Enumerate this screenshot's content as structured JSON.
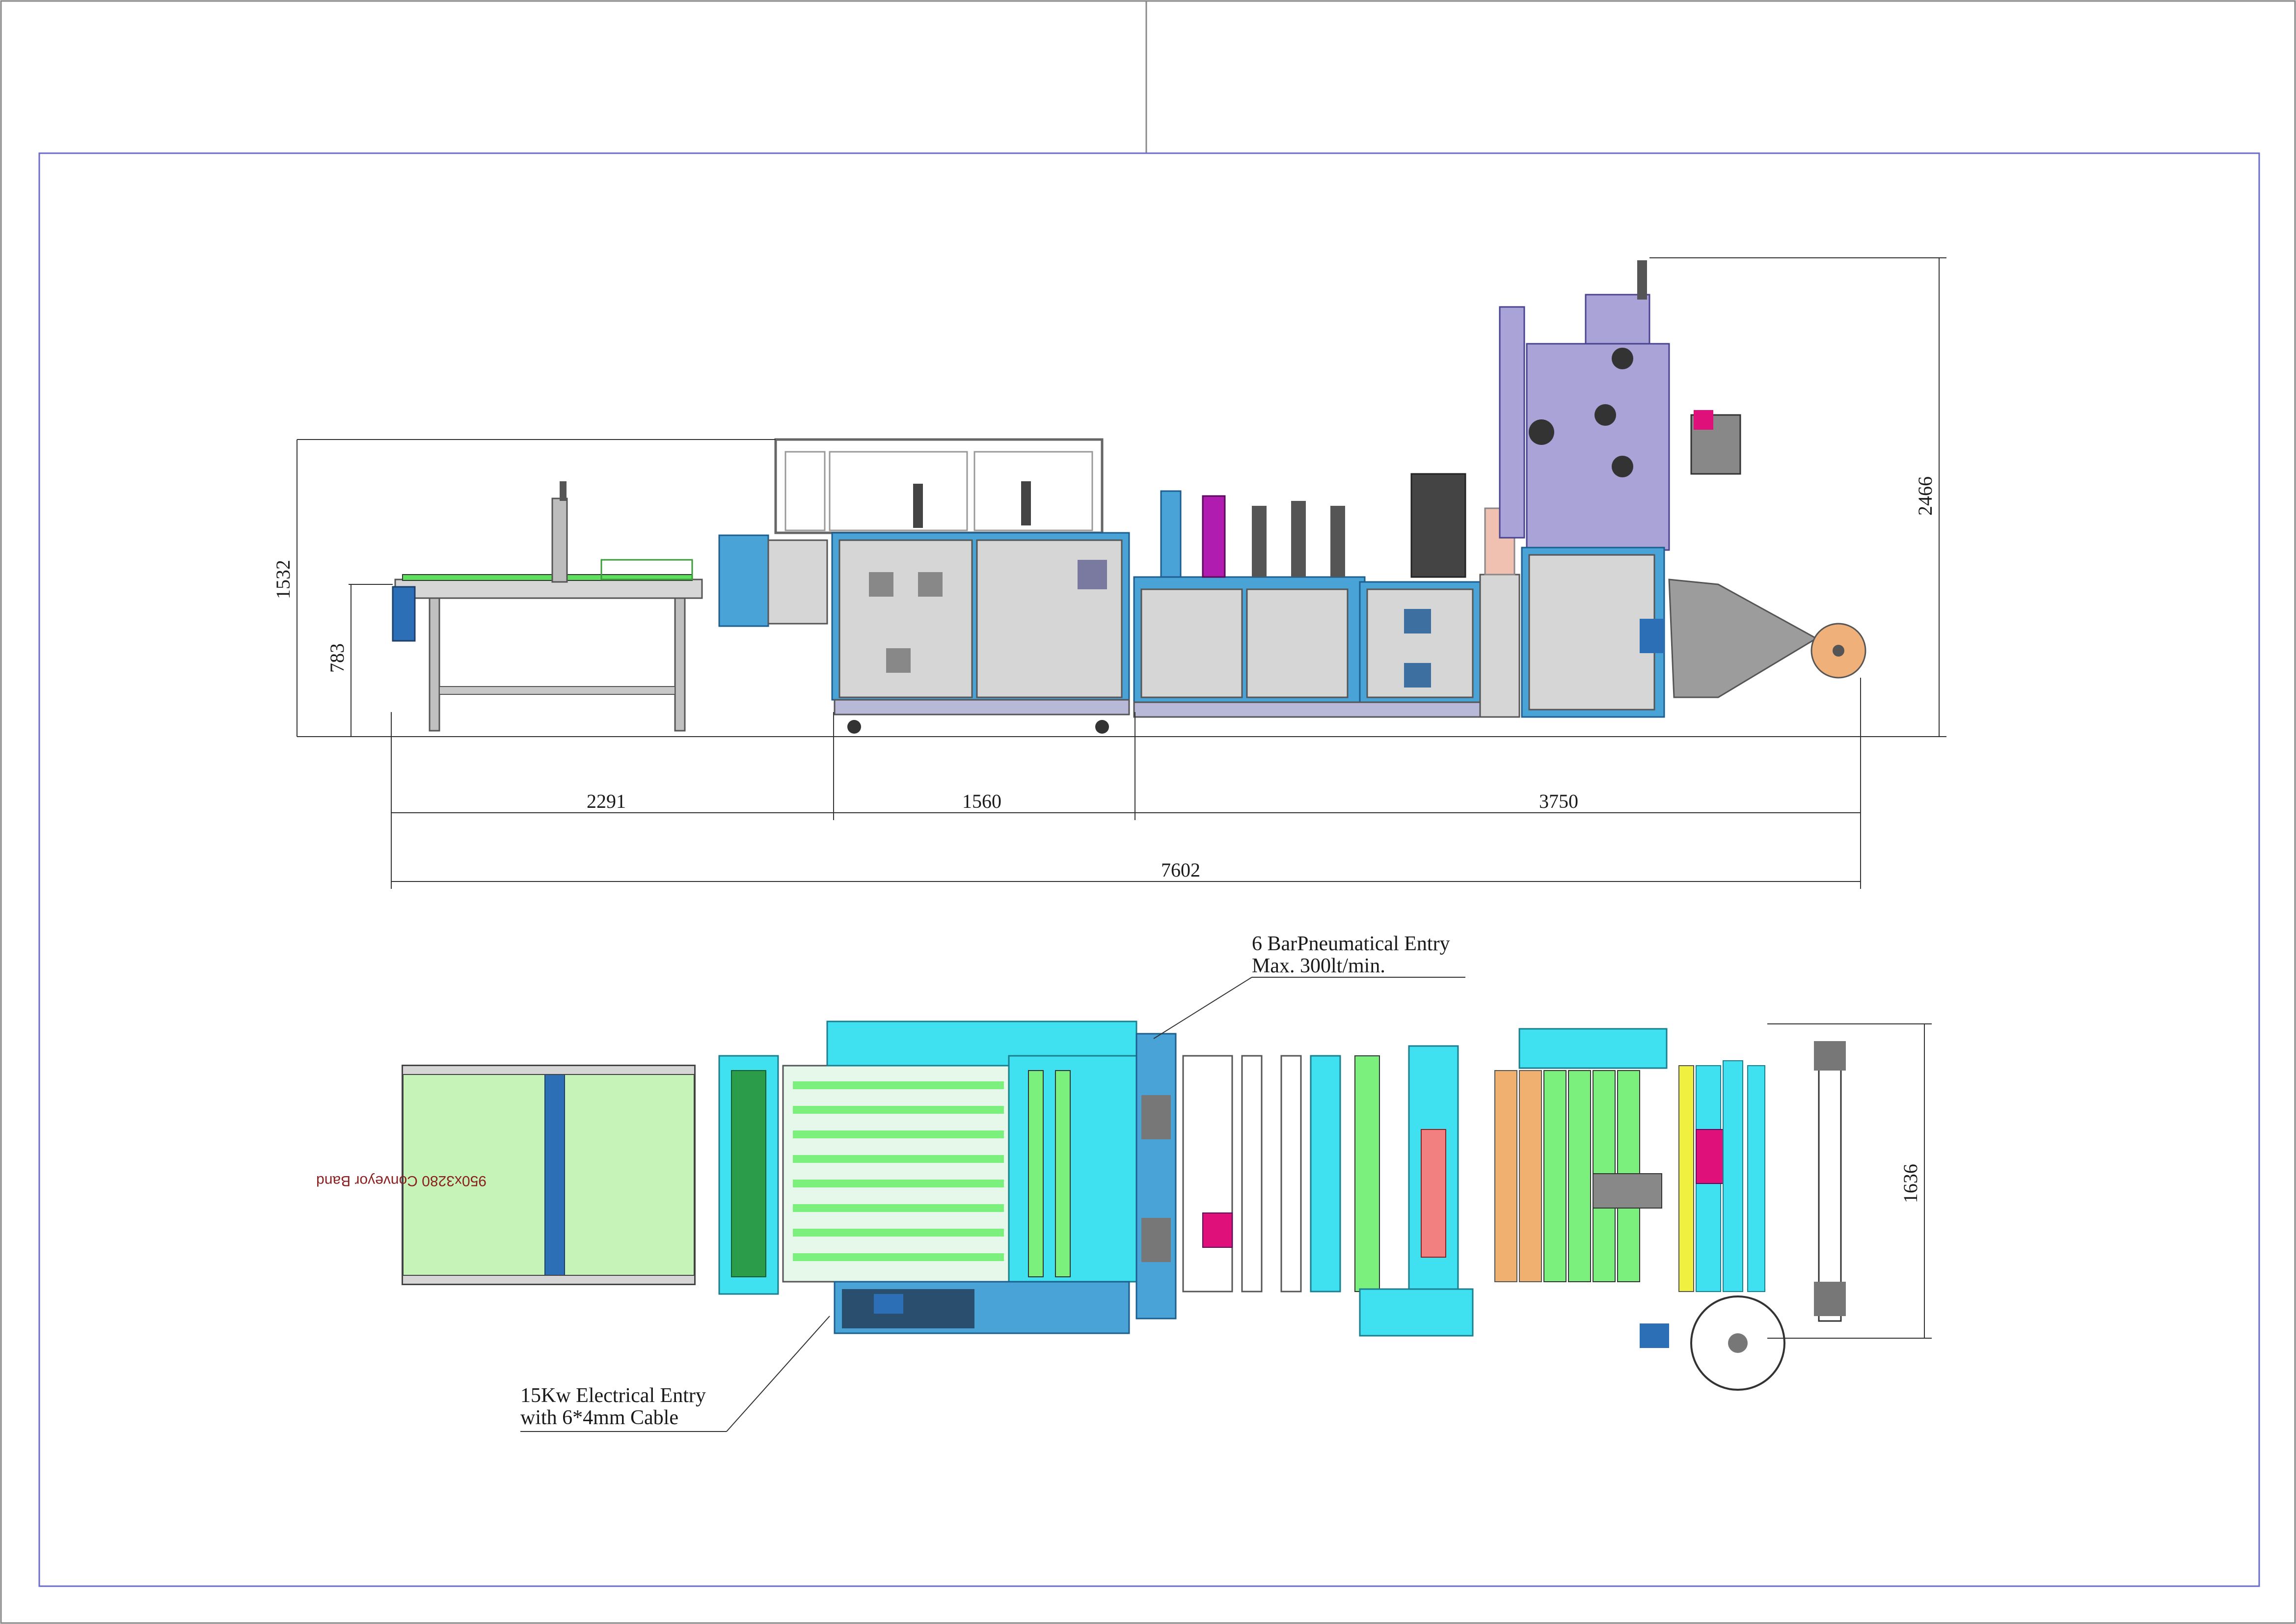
{
  "side_view": {
    "dimensions": {
      "height_total": "2466",
      "height_guard": "1532",
      "height_conveyor": "783",
      "len_conveyor": "2291",
      "len_middle": "1560",
      "len_right": "3750",
      "len_total": "7602"
    }
  },
  "top_view": {
    "dimensions": {
      "width_total": "1636"
    },
    "conveyor_belt_text": "950x3280 Conveyor Band",
    "pneumatic_note": {
      "line1": "6 BarPneumatical Entry",
      "line2": "Max. 300lt/min."
    },
    "electrical_note": {
      "line1": "15Kw Electrical Entry",
      "line2": "with 6*4mm Cable"
    }
  },
  "colors": {
    "frame_blue": "#4aa3d6",
    "panel_grey": "#d6d6d6",
    "frame_lavender": "#a9a3d8",
    "cyan": "#3fe0f0",
    "green": "#7cf07c",
    "belt_green": "#c6f3b8",
    "magenta": "#e0107a",
    "orange": "#f0b070",
    "yellow": "#f0f040",
    "border": "#6b6bc9"
  }
}
